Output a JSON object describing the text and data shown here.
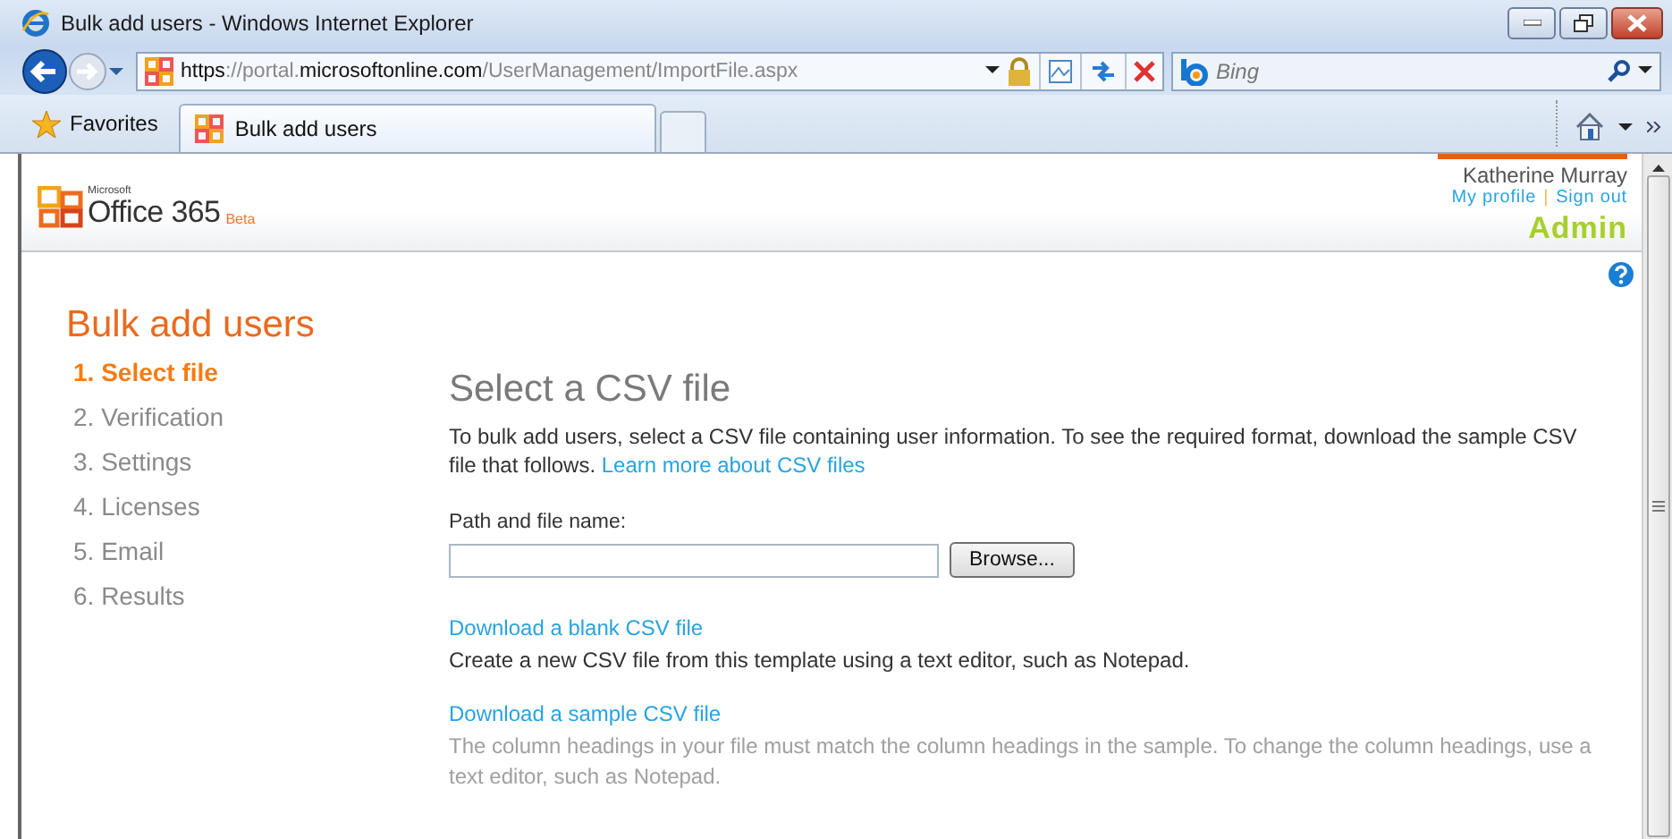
{
  "window": {
    "title": "Bulk add users - Windows Internet Explorer"
  },
  "address_bar": {
    "url": "**https**://portal.**microsoftonline.com**/UserManagement/ImportFile.aspx"
  },
  "search": {
    "placeholder": "Bing"
  },
  "favorites": {
    "label": "Favorites"
  },
  "tabs": [
    {
      "label": "Bulk add users",
      "selected": true
    }
  ],
  "header": {
    "brand_small": "Microsoft",
    "brand": "Office 365",
    "edition": "Beta",
    "user": "Katherine Murray",
    "links": [
      "My profile",
      "Sign out"
    ],
    "separator": "|",
    "role": "Admin"
  },
  "page": {
    "title": "Bulk add users"
  },
  "steps": [
    {
      "label": "1. Select file",
      "selected": true
    },
    {
      "label": "2. Verification",
      "selected": false
    },
    {
      "label": "3. Settings",
      "selected": false
    },
    {
      "label": "4. Licenses",
      "selected": false
    },
    {
      "label": "5. Email",
      "selected": false
    },
    {
      "label": "6. Results",
      "selected": false
    }
  ],
  "content": {
    "heading": "Select a CSV file",
    "intro": "To bulk add users, select a CSV file containing user information. To see the required format, download the sample CSV file that follows.",
    "intro_link": "Learn more about CSV files",
    "field_label": "Path and file name:",
    "browse_button": "Browse...",
    "downloads": [
      {
        "link": "Download a blank CSV file",
        "description": "Create a new CSV file from this template using a text editor, such as Notepad.",
        "muted": false
      },
      {
        "link": "Download a sample CSV file",
        "description": "The column headings in your file must match the column headings in the sample. To change the column headings, use a text editor, such as Notepad.",
        "muted": true
      }
    ]
  }
}
